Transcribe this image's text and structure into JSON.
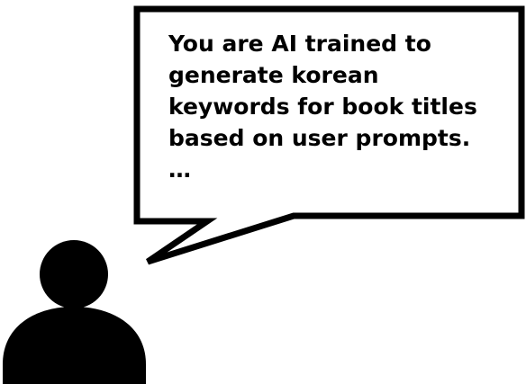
{
  "speech_bubble": {
    "lines": [
      "You are AI trained to",
      "generate korean",
      "keywords for book titles",
      "based on user prompts.",
      "…"
    ]
  },
  "icons": {
    "person": "person-icon",
    "bubble": "speech-bubble"
  },
  "colors": {
    "ink": "#000000",
    "background": "#ffffff"
  }
}
